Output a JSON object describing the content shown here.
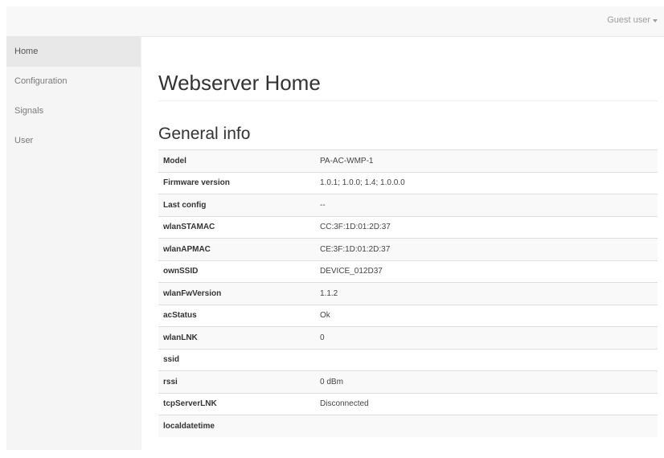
{
  "header": {
    "user_menu_label": "Guest user"
  },
  "sidebar": {
    "items": [
      {
        "label": "Home",
        "active": true
      },
      {
        "label": "Configuration",
        "active": false
      },
      {
        "label": "Signals",
        "active": false
      },
      {
        "label": "User",
        "active": false
      }
    ]
  },
  "main": {
    "page_title": "Webserver Home",
    "section_title": "General info",
    "rows": [
      {
        "key": "Model",
        "value": "PA-AC-WMP-1"
      },
      {
        "key": "Firmware version",
        "value": "1.0.1; 1.0.0; 1.4; 1.0.0.0"
      },
      {
        "key": "Last config",
        "value": "--"
      },
      {
        "key": "wlanSTAMAC",
        "value": "CC:3F:1D:01:2D:37"
      },
      {
        "key": "wlanAPMAC",
        "value": "CE:3F:1D:01:2D:37"
      },
      {
        "key": "ownSSID",
        "value": "DEVICE_012D37"
      },
      {
        "key": "wlanFwVersion",
        "value": "1.1.2"
      },
      {
        "key": "acStatus",
        "value": "Ok"
      },
      {
        "key": "wlanLNK",
        "value": "0"
      },
      {
        "key": "ssid",
        "value": ""
      },
      {
        "key": "rssi",
        "value": "0 dBm"
      },
      {
        "key": "tcpServerLNK",
        "value": "Disconnected"
      },
      {
        "key": "localdatetime",
        "value": ""
      }
    ]
  },
  "colors": {
    "page_bg": "#f1f1f1",
    "navbar_bg": "#f8f8f8",
    "sidebar_bg": "#f5f5f5",
    "active_item_bg": "#e8e8e8",
    "table_stripe": "#f9f9f9"
  },
  "icons": {
    "user_menu": "caret-down-icon"
  }
}
